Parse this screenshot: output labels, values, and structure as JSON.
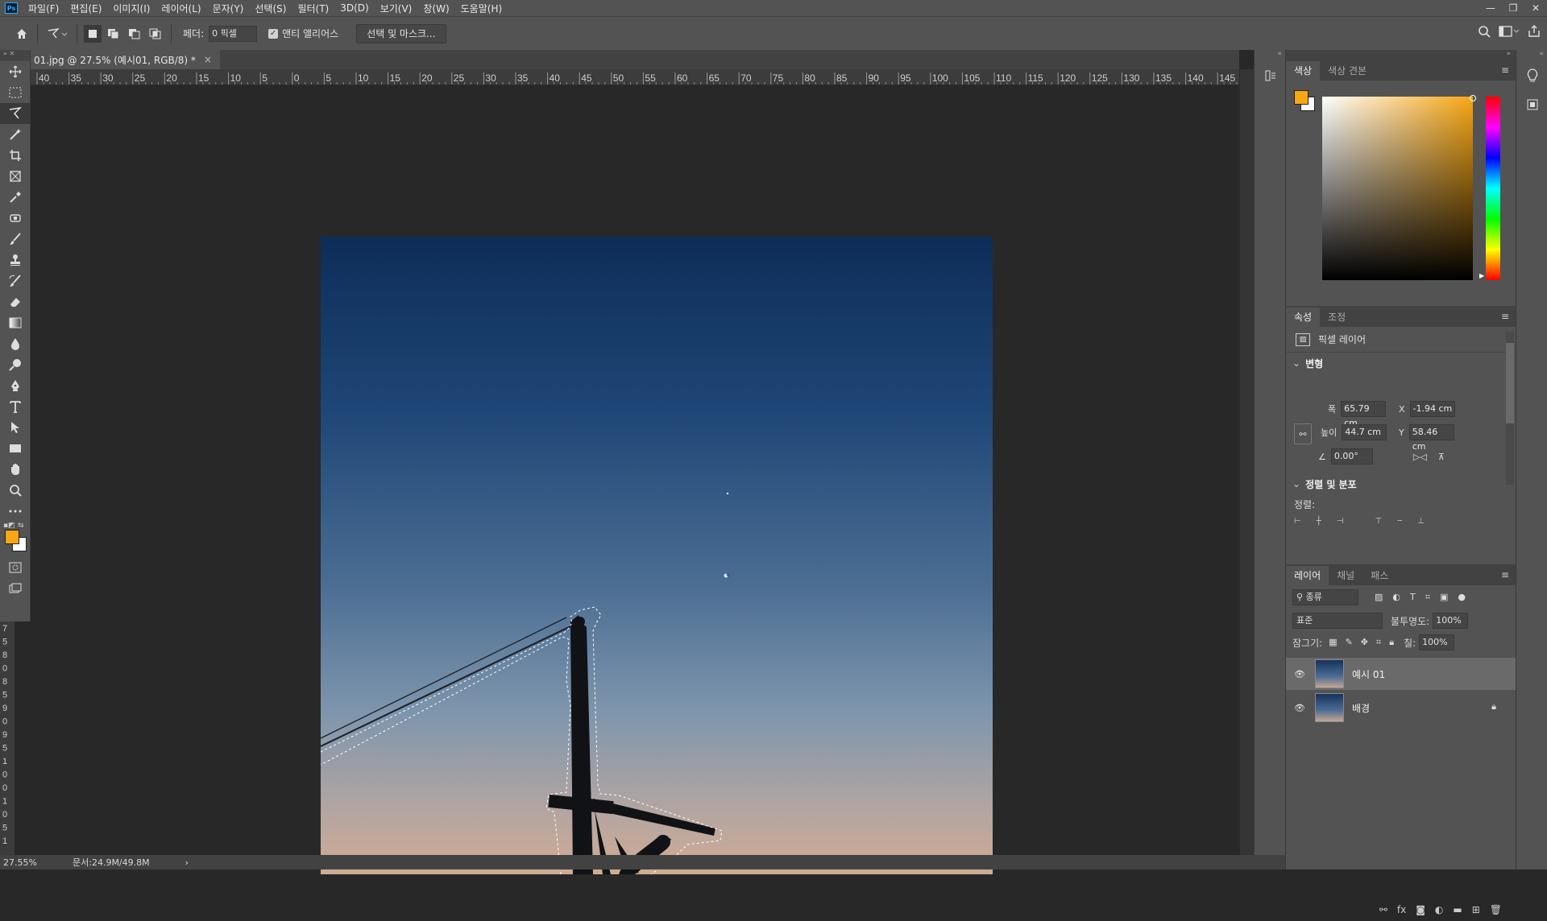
{
  "menu": {
    "items": [
      "파일(F)",
      "편집(E)",
      "이미지(I)",
      "레이어(L)",
      "문자(Y)",
      "선택(S)",
      "필터(T)",
      "3D(D)",
      "보기(V)",
      "창(W)",
      "도움말(H)"
    ]
  },
  "options": {
    "feather_label": "페더:",
    "feather_value": "0 픽셀",
    "anti_alias_label": "앤티 앨리어스",
    "select_mask_button": "선택 및 마스크..."
  },
  "document": {
    "tab_title": "01.jpg @ 27.5% (예시01, RGB/8) *",
    "close": "×"
  },
  "ruler": {
    "h_labels": [
      "40",
      "35",
      "30",
      "25",
      "20",
      "15",
      "10",
      "5",
      "0",
      "5",
      "10",
      "15",
      "20",
      "25",
      "30",
      "35",
      "40",
      "45",
      "50",
      "55",
      "60",
      "65",
      "70",
      "75",
      "80",
      "85",
      "90",
      "95",
      "100",
      "105",
      "110",
      "115",
      "120",
      "125",
      "130",
      "135",
      "140",
      "145"
    ],
    "v_labels": [
      "7",
      "5",
      "8",
      "0",
      "8",
      "5",
      "9",
      "0",
      "9",
      "5",
      "1",
      "0",
      "0",
      "1",
      "0",
      "5",
      "1"
    ]
  },
  "status": {
    "zoom": "27.55%",
    "doc_info": "문서:24.9M/49.8M",
    "arrow": "›"
  },
  "color_panel": {
    "tabs": [
      "색상",
      "색상 견본"
    ],
    "foreground": "#f7a614",
    "background": "#ffffff"
  },
  "properties_panel": {
    "tabs": [
      "속성",
      "조정"
    ],
    "layer_type": "픽셀 레이어",
    "transform_title": "변형",
    "width_label": "폭",
    "width_value": "65.79 cm",
    "height_label": "높이",
    "height_value": "44.7 cm",
    "x_label": "X",
    "x_value": "-1.94 cm",
    "y_label": "Y",
    "y_value": "58.46 cm",
    "angle_value": "0.00°",
    "align_title": "정렬 및 분포",
    "align_label": "정렬:"
  },
  "layers_panel": {
    "tabs": [
      "레이어",
      "채널",
      "패스"
    ],
    "kind_filter": "종류",
    "blend_mode": "표준",
    "opacity_label": "불투명도:",
    "opacity_value": "100%",
    "lock_label": "잠그기:",
    "fill_label": "칠:",
    "fill_value": "100%",
    "layers": [
      {
        "name": "예시 01",
        "selected": true,
        "locked": false
      },
      {
        "name": "배경",
        "selected": false,
        "locked": true
      }
    ]
  },
  "icons": {
    "toolbar": [
      "move-icon",
      "marquee-icon",
      "polygonal-lasso-icon",
      "magic-wand-icon",
      "crop-icon",
      "frame-icon",
      "eyedropper-icon",
      "healing-icon",
      "brush-icon",
      "stamp-icon",
      "history-brush-icon",
      "eraser-icon",
      "gradient-icon",
      "blur-icon",
      "dodge-icon",
      "pen-icon",
      "type-icon",
      "path-select-icon",
      "rectangle-icon",
      "hand-icon",
      "zoom-icon",
      "more-icon"
    ]
  },
  "colors": {
    "app_bg": "#282828",
    "panel_bg": "#535353",
    "accent": "#31a8ff"
  }
}
